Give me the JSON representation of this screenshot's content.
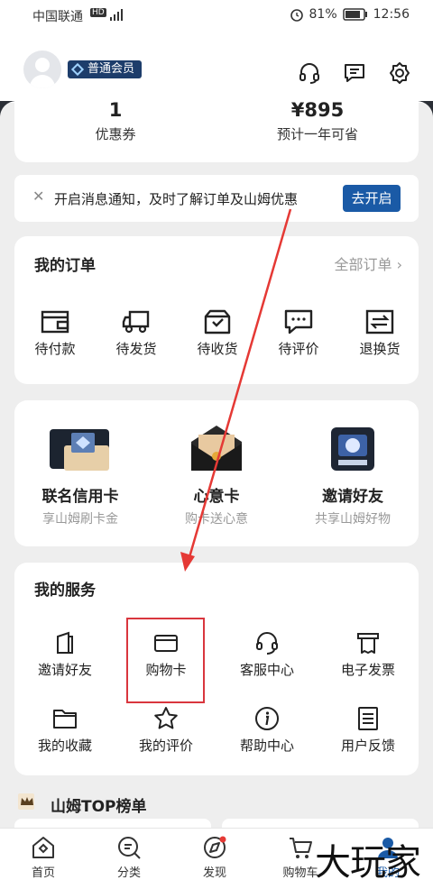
{
  "status_bar": {
    "carrier": "中国联通",
    "network": "HD 4G",
    "battery": "81%",
    "time": "12:56"
  },
  "header": {
    "member_badge": "普通会员"
  },
  "stats": [
    {
      "value": "1",
      "label": "优惠券"
    },
    {
      "value": "¥895",
      "label": "预计一年可省"
    }
  ],
  "notice": {
    "text": "开启消息通知，及时了解订单及山姆优惠",
    "button": "去开启"
  },
  "orders": {
    "title": "我的订单",
    "all": "全部订单",
    "items": [
      {
        "label": "待付款",
        "icon": "wallet-icon"
      },
      {
        "label": "待发货",
        "icon": "truck-icon"
      },
      {
        "label": "待收货",
        "icon": "box-icon"
      },
      {
        "label": "待评价",
        "icon": "comment-icon"
      },
      {
        "label": "退换货",
        "icon": "exchange-icon"
      }
    ]
  },
  "promos": [
    {
      "title": "联名信用卡",
      "subtitle": "享山姆刷卡金"
    },
    {
      "title": "心意卡",
      "subtitle": "购卡送心意"
    },
    {
      "title": "邀请好友",
      "subtitle": "共享山姆好物"
    }
  ],
  "services": {
    "title": "我的服务",
    "items": [
      {
        "label": "邀请好友",
        "icon": "invite-icon"
      },
      {
        "label": "购物卡",
        "icon": "card-icon"
      },
      {
        "label": "客服中心",
        "icon": "headset-icon"
      },
      {
        "label": "电子发票",
        "icon": "invoice-icon"
      },
      {
        "label": "我的收藏",
        "icon": "folder-icon"
      },
      {
        "label": "我的评价",
        "icon": "star-icon"
      },
      {
        "label": "帮助中心",
        "icon": "info-icon"
      },
      {
        "label": "用户反馈",
        "icon": "feedback-icon"
      }
    ]
  },
  "top_list": {
    "title": "山姆TOP榜单"
  },
  "tabs": [
    {
      "label": "首页",
      "icon": "home-icon"
    },
    {
      "label": "分类",
      "icon": "search-icon"
    },
    {
      "label": "发现",
      "icon": "compass-icon"
    },
    {
      "label": "购物车",
      "icon": "cart-icon"
    },
    {
      "label": "我的",
      "icon": "user-icon"
    }
  ],
  "watermark": "大玩家",
  "colors": {
    "accent": "#1a5aa6",
    "highlight": "#d9363e",
    "badge": "#1d3d6b"
  }
}
